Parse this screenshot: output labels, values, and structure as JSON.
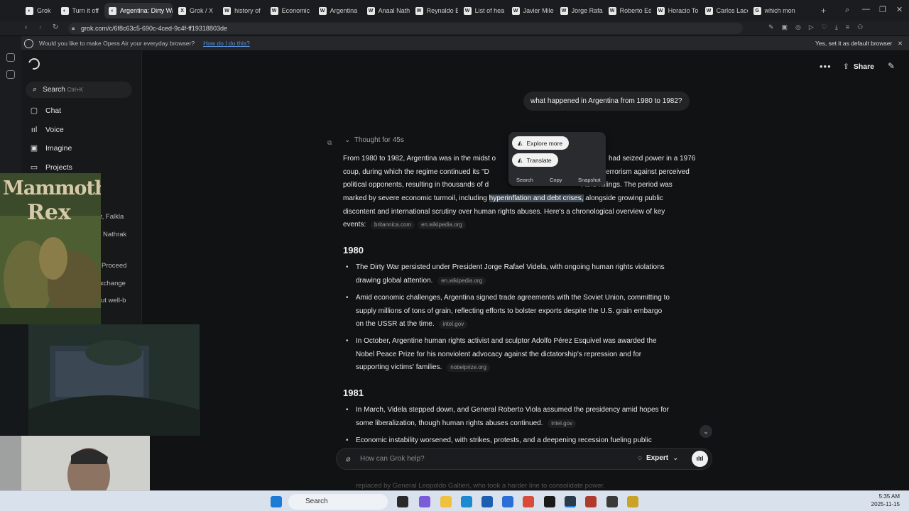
{
  "browser": {
    "tabs": [
      {
        "label": "Grok",
        "icon": "grok-icon"
      },
      {
        "label": "Turn it off",
        "icon": "grok-icon"
      },
      {
        "label": "Argentina: Dirty War",
        "icon": "grok-icon",
        "active": true
      },
      {
        "label": "Grok / X",
        "icon": "x-icon"
      },
      {
        "label": "history of",
        "icon": "wikipedia-icon"
      },
      {
        "label": "Economic",
        "icon": "wikipedia-icon"
      },
      {
        "label": "Argentina",
        "icon": "wikipedia-icon"
      },
      {
        "label": "Anaal Nath",
        "icon": "wikipedia-icon"
      },
      {
        "label": "Reynaldo B",
        "icon": "wikipedia-icon"
      },
      {
        "label": "List of hea",
        "icon": "wikipedia-icon"
      },
      {
        "label": "Javier Mile",
        "icon": "wikipedia-icon"
      },
      {
        "label": "Jorge Rafa",
        "icon": "wikipedia-icon"
      },
      {
        "label": "Roberto Ed",
        "icon": "wikipedia-icon"
      },
      {
        "label": "Horacio To",
        "icon": "wikipedia-icon"
      },
      {
        "label": "Carlos Laco",
        "icon": "wikipedia-icon"
      },
      {
        "label": "which mon",
        "icon": "google-icon"
      }
    ],
    "url": "grok.com/c/6f8c63c5-690c-4ced-9c4f-ff19318803de",
    "infobar_text": "Would you like to make Opera Air your everyday browser?",
    "infobar_link": "How do I do this?",
    "infobar_button": "Yes, set it as default browser"
  },
  "sidebar": {
    "search_label": "Search",
    "search_shortcut": "Ctrl+K",
    "items": [
      "Chat",
      "Voice",
      "Imagine",
      "Projects"
    ],
    "partial_items": [
      "r, Falkla",
      "Nathrak",
      "Proceed",
      "xchange",
      "ut well-b"
    ]
  },
  "header": {
    "share_label": "Share"
  },
  "chat": {
    "user_message": "what happened in Argentina from 1980 to 1982?",
    "thought": "Thought for 45s",
    "intro": {
      "l1a": "From 1980 to 1982, Argentina was in the midst o",
      "l1b": "had seized power in a 1976",
      "l2a": "coup, during which the regime continued its \"D",
      "l2b": "errorism against perceived",
      "l3a": "political opponents, resulting in thousands of d",
      "l3b": ", and killings. The period was",
      "l4a": "marked by severe economic turmoil, including ",
      "l4hl": "hyperinflation and debt crises,",
      "l4b": " alongside growing public",
      "l5": "discontent and international scrutiny over human rights abuses. Here's a chronological overview of key",
      "l6": "events:",
      "src1": "britannica.com",
      "src2": "en.wikipedia.org"
    },
    "sections": [
      {
        "year": "1980",
        "items": [
          {
            "lines": [
              "The Dirty War persisted under President Jorge Rafael Videla, with ongoing human rights violations",
              "drawing global attention."
            ],
            "source": "en.wikipedia.org"
          },
          {
            "lines": [
              "Amid economic challenges, Argentina signed trade agreements with the Soviet Union, committing to",
              "supply millions of tons of grain, reflecting efforts to bolster exports despite the U.S. grain embargo",
              "on the USSR at the time."
            ],
            "source": "intel.gov"
          },
          {
            "lines": [
              "In October, Argentine human rights activist and sculptor Adolfo Pérez Esquivel was awarded the",
              "Nobel Peace Prize for his nonviolent advocacy against the dictatorship's repression and for",
              "supporting victims' families."
            ],
            "source": "nobelprize.org"
          }
        ]
      },
      {
        "year": "1981",
        "items": [
          {
            "lines": [
              "In March, Videla stepped down, and General Roberto Viola assumed the presidency amid hopes for",
              "some liberalization, though human rights abuses continued."
            ],
            "source": "intel.gov"
          },
          {
            "lines": [
              "Economic instability worsened, with strikes, protests, and a deepening recession fueling public"
            ],
            "source": ""
          }
        ]
      }
    ],
    "faded_lines": [
      "replaced by General Leopoldo Galtieri, who took a harder line to consolidate power."
    ]
  },
  "popup": {
    "explore": "Explore more",
    "translate": "Translate",
    "actions": [
      "Search",
      "Copy",
      "Snapshot"
    ]
  },
  "composer": {
    "placeholder": "How can Grok help?",
    "mode": "Expert"
  },
  "overlay": {
    "title_art": "Mammoth Rex"
  },
  "taskbar": {
    "search": "Search",
    "time": "5:35 AM",
    "date": "2025-11-15"
  }
}
